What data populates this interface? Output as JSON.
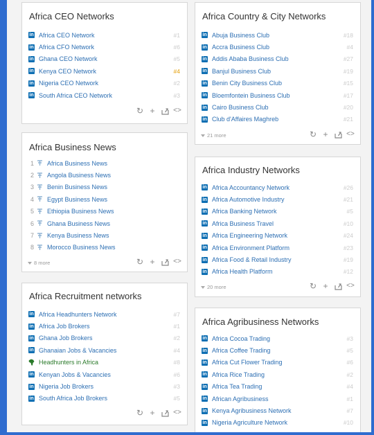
{
  "cards": {
    "ceo": {
      "title": "Africa CEO Networks",
      "items": [
        {
          "label": "Africa CEO Network",
          "rank": "#1"
        },
        {
          "label": "Africa CFO Network",
          "rank": "#6"
        },
        {
          "label": "Ghana CEO Network",
          "rank": "#5"
        },
        {
          "label": "Kenya CEO Network",
          "rank": "#4"
        },
        {
          "label": "Nigeria CEO Network",
          "rank": "#2"
        },
        {
          "label": "South Africa CEO Network",
          "rank": "#3"
        }
      ]
    },
    "news": {
      "title": "Africa Business News",
      "items": [
        {
          "num": "1",
          "label": "Africa Business News"
        },
        {
          "num": "2",
          "label": "Angola Business News"
        },
        {
          "num": "3",
          "label": "Benin Business News"
        },
        {
          "num": "4",
          "label": "Egypt Business News"
        },
        {
          "num": "5",
          "label": "Ethiopia Business News"
        },
        {
          "num": "6",
          "label": "Ghana Business News"
        },
        {
          "num": "7",
          "label": "Kenya Business News"
        },
        {
          "num": "8",
          "label": "Morocco Business News"
        }
      ],
      "more": "8 more"
    },
    "recruit": {
      "title": "Africa Recruitment networks",
      "items": [
        {
          "label": "Africa Headhunters Network",
          "rank": "#7"
        },
        {
          "label": "Africa Job Brokers",
          "rank": "#1"
        },
        {
          "label": "Ghana Job Brokers",
          "rank": "#2"
        },
        {
          "label": "Ghanaian Jobs & Vacancies",
          "rank": "#4"
        },
        {
          "label": "Headhunters in Africa",
          "rank": "#8"
        },
        {
          "label": "Kenyan Jobs & Vacancies",
          "rank": "#6"
        },
        {
          "label": "Nigeria Job Brokers",
          "rank": "#3"
        },
        {
          "label": "South Africa Job Brokers",
          "rank": "#5"
        }
      ]
    },
    "country": {
      "title": "Africa Country & City Networks",
      "items": [
        {
          "label": "Abuja Business Club",
          "rank": "#18"
        },
        {
          "label": "Accra Business Club",
          "rank": "#4"
        },
        {
          "label": "Addis Ababa Business Club",
          "rank": "#27"
        },
        {
          "label": "Banjul Business Club",
          "rank": "#19"
        },
        {
          "label": "Benin City Business Club",
          "rank": "#15"
        },
        {
          "label": "Bloemfontein Business Club",
          "rank": "#17"
        },
        {
          "label": "Cairo Business Club",
          "rank": "#20"
        },
        {
          "label": "Club d'Affaires Maghreb",
          "rank": "#21"
        }
      ],
      "more": "21 more"
    },
    "industry": {
      "title": "Africa Industry Networks",
      "items": [
        {
          "label": "Africa Accountancy Network",
          "rank": "#26"
        },
        {
          "label": "Africa Automotive Industry",
          "rank": "#21"
        },
        {
          "label": "Africa Banking Network",
          "rank": "#5"
        },
        {
          "label": "Africa Business Travel",
          "rank": "#10"
        },
        {
          "label": "Africa Engineering Network",
          "rank": "#24"
        },
        {
          "label": "Africa Environment Platform",
          "rank": "#23"
        },
        {
          "label": "Africa Food & Retail Industry",
          "rank": "#19"
        },
        {
          "label": "Africa Health Platform",
          "rank": "#12"
        }
      ],
      "more": "20 more"
    },
    "agri": {
      "title": "Africa Agribusiness Networks",
      "items": [
        {
          "label": "Africa Cocoa Trading",
          "rank": "#3"
        },
        {
          "label": "Africa Coffee Trading",
          "rank": "#5"
        },
        {
          "label": "Africa Cut Flower Trading",
          "rank": "#6"
        },
        {
          "label": "Africa Rice Trading",
          "rank": "#2"
        },
        {
          "label": "Africa Tea Trading",
          "rank": "#4"
        },
        {
          "label": "African Agribusiness",
          "rank": "#1"
        },
        {
          "label": "Kenya Agribusiness Network",
          "rank": "#7"
        },
        {
          "label": "Nigeria Agriculture Network",
          "rank": "#10"
        }
      ]
    }
  },
  "icons": {
    "list_badge": "in",
    "actions": [
      "refresh-icon",
      "add-icon",
      "share-icon",
      "embed-icon"
    ]
  },
  "colors": {
    "frame": "#2f6ccf",
    "link": "#2d6fb3",
    "badge": "#0f6fb3",
    "highlight_rank": "#e5a00d",
    "africa_icon": "#2a7a2a"
  }
}
